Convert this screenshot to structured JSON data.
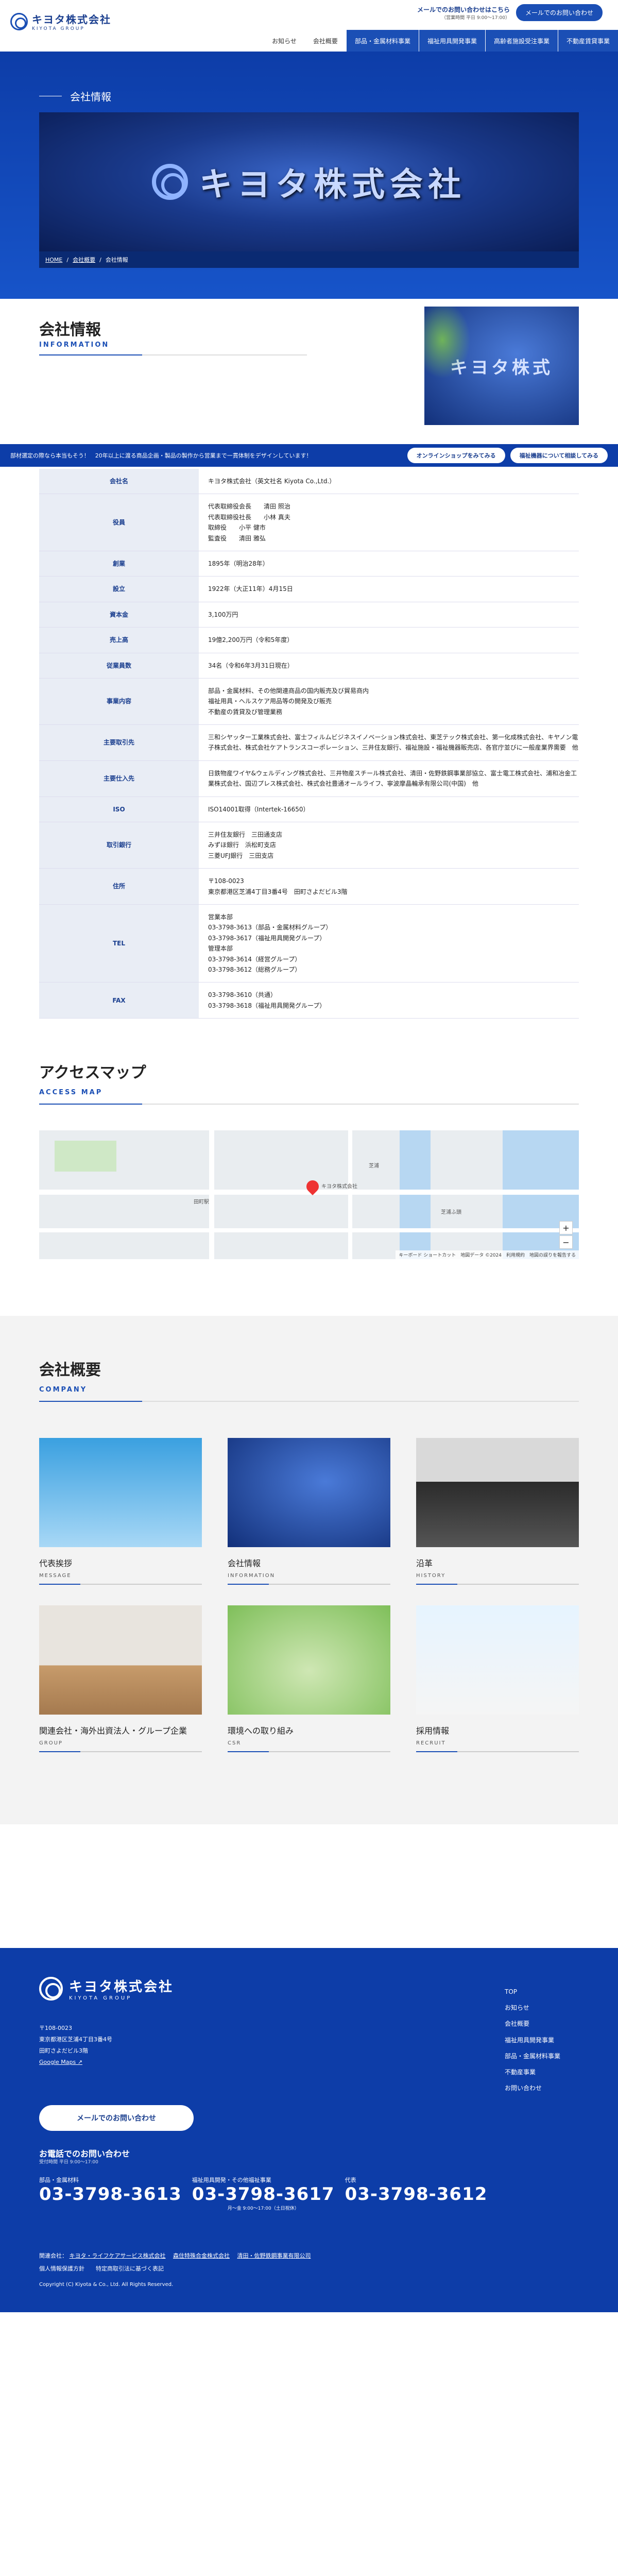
{
  "header": {
    "logo_jp": "キヨタ株式会社",
    "logo_en": "KIYOTA GROUP",
    "contact_text": "メールでのお問い合わせはこちら",
    "contact_sub": "（営業時間 平日 9:00〜17:00）",
    "mail_button": "メールでのお問い合わせ",
    "nav": [
      "お知らせ",
      "会社概要",
      "部品・金属材料事業",
      "福祉用具開発事業",
      "高齢者施設受注事業",
      "不動産賃貸事業"
    ]
  },
  "hero": {
    "label": "会社情報",
    "image_text": "キヨタ株式会社",
    "breadcrumb": [
      "HOME",
      "会社概要",
      "会社情報"
    ]
  },
  "info": {
    "title": "会社情報",
    "subtitle": "INFORMATION",
    "image_text": "キヨタ株式"
  },
  "banner": {
    "text": "部材選定の際なら本当もそう！　20年以上に渡る商品企画・製品の製作から営業まで一貫体制をデザインしています！",
    "btn1": "オンラインショップをみてみる",
    "btn2": "福祉機器について相談してみる"
  },
  "table": [
    {
      "k": "会社名",
      "v": [
        "キヨタ株式会社（英文社名 Kiyota Co.,Ltd.）"
      ]
    },
    {
      "k": "役員",
      "v": [
        "代表取締役会長　　清田 照治",
        "代表取締役社長　　小林 真夫",
        "取締役　　小平 健市",
        "監査役　　清田 雅弘"
      ]
    },
    {
      "k": "創業",
      "v": [
        "1895年（明治28年）"
      ]
    },
    {
      "k": "設立",
      "v": [
        "1922年（大正11年）4月15日"
      ]
    },
    {
      "k": "資本金",
      "v": [
        "3,100万円"
      ]
    },
    {
      "k": "売上高",
      "v": [
        "19億2,200万円（令和5年度）"
      ]
    },
    {
      "k": "従業員数",
      "v": [
        "34名（令和6年3月31日現在）"
      ]
    },
    {
      "k": "事業内容",
      "v": [
        "部品・金属材料、その他関連商品の国内販売及び貿易商内",
        "福祉用具・ヘルスケア用品等の開発及び販売",
        "不動産の賃貸及び管理業務"
      ]
    },
    {
      "k": "主要取引先",
      "v": [
        "三和シヤッター工業株式会社、富士フィルムビジネスイノベーション株式会社、東芝テック株式会社、第一化成株式会社、キヤノン電子株式会社、株式会社ケアトランスコーポレーション、三井住友銀行、福祉施設・福祉機器販売店、各官庁並びに一般産業界需要　他"
      ]
    },
    {
      "k": "主要仕入先",
      "v": [
        "日鉄物産ワイヤ&ウェルディング株式会社、三井物産スチール株式会社、清田・佐野鉄鋼事業部協立、富士電工株式会社、浦和冶金工業株式会社、国辺プレス株式会社、株式会社豊通オールライフ、寧波摩晶輪承有限公司(中国)　他"
      ]
    },
    {
      "k": "ISO",
      "v": [
        "ISO14001取得（Intertek-16650）"
      ]
    },
    {
      "k": "取引銀行",
      "v": [
        "三井住友銀行　三田通支店",
        "みずほ銀行　浜松町支店",
        "三菱UFJ銀行　三田支店"
      ]
    },
    {
      "k": "住所",
      "v": [
        "〒108-0023",
        "東京都港区芝浦4丁目3番4号　田町さよだビル3階"
      ]
    },
    {
      "k": "TEL",
      "v": [
        "営業本部",
        "03-3798-3613（部品・金属材料グループ）",
        "03-3798-3617（福祉用具開発グループ）",
        "管理本部",
        "03-3798-3614（経営グループ）",
        "03-3798-3612（総務グループ）"
      ]
    },
    {
      "k": "FAX",
      "v": [
        "03-3798-3610（共通）",
        "03-3798-3618（福祉用具開発グループ）"
      ]
    }
  ],
  "access": {
    "title": "アクセスマップ",
    "subtitle": "ACCESS MAP",
    "map_labels": [
      "田町駅",
      "芝浦",
      "キヨタ株式会社",
      "芝浦ふ頭"
    ],
    "map_footer": "キーボード ショートカット　地図データ ©2024　利用規約　地図の誤りを報告する"
  },
  "company": {
    "title": "会社概要",
    "subtitle": "COMPANY",
    "cards": [
      {
        "t": "代表挨拶",
        "e": "MESSAGE"
      },
      {
        "t": "会社情報",
        "e": "INFORMATION"
      },
      {
        "t": "沿革",
        "e": "HISTORY"
      },
      {
        "t": "関連会社・海外出資法人・グループ企業",
        "e": "GROUP"
      },
      {
        "t": "環境への取り組み",
        "e": "CSR"
      },
      {
        "t": "採用情報",
        "e": "RECRUIT"
      }
    ]
  },
  "footer": {
    "logo_jp": "キヨタ株式会社",
    "logo_en": "KIYOTA GROUP",
    "addr1": "〒108-0023",
    "addr2": "東京都港区芝浦4丁目3番4号",
    "addr3": "田町さよだビル3階",
    "gmap": "Google Maps ↗",
    "mail": "メールでのお問い合わせ",
    "tel_h": "お電話でのお問い合わせ",
    "tel_s": "受付時間 平日 9:00〜17:00",
    "tels": [
      {
        "lb": "部品・金属材料",
        "n": "03-3798-3613"
      },
      {
        "lb": "福祉用具開発・その他福祉事業",
        "n": "03-3798-3617"
      },
      {
        "lb": "代表",
        "n": "03-3798-3612"
      }
    ],
    "hours": "月〜金 9:00〜17:00（土日祝休）",
    "links": [
      "TOP",
      "お知らせ",
      "会社概要",
      "福祉用具開発事業",
      "部品・金属材料事業",
      "不動産事業",
      "お問い合わせ"
    ],
    "related_label": "関連会社：",
    "related": [
      "キヨタ・ライフケアサービス株式会社",
      "森住特殊合金株式会社",
      "清田・佐野鉄鋼事業有限公司"
    ],
    "related2": "個人情報保護方針　　特定商取引法に基づく表記",
    "copy": "Copyright (C) Kiyota & Co., Ltd. All Rights Reserved."
  }
}
